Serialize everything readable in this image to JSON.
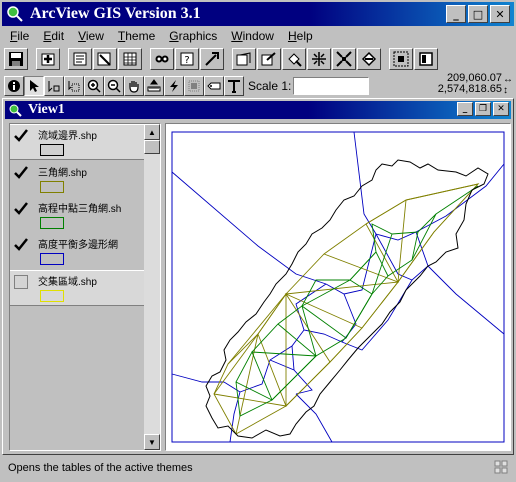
{
  "app": {
    "title": "ArcView GIS Version 3.1"
  },
  "menu": [
    "File",
    "Edit",
    "View",
    "Theme",
    "Graphics",
    "Window",
    "Help"
  ],
  "toolbar_buttons": [
    "save-icon",
    "add-theme-icon",
    "theme-properties-icon",
    "edit-legend-icon",
    "open-table-icon",
    "find-icon",
    "query-icon",
    "locate-address-icon",
    "zoom-full-icon",
    "zoom-to-themes-icon",
    "zoom-to-selected-icon",
    "zoom-in-icon",
    "zoom-out-icon",
    "zoom-previous-icon",
    "select-features-icon",
    "layout-icon"
  ],
  "tools": [
    "info-tool-icon",
    "pointer-tool-icon",
    "vertex-edit-icon",
    "select-box-icon",
    "zoom-in-tool-icon",
    "zoom-out-tool-icon",
    "pan-icon",
    "measure-icon",
    "hotlink-icon",
    "area-select-icon",
    "label-icon",
    "text-tool-icon"
  ],
  "scale": {
    "label": "Scale 1:",
    "value": ""
  },
  "coords": {
    "x": "209,060.07",
    "y": "2,574,818.65"
  },
  "view": {
    "title": "View1"
  },
  "themes": [
    {
      "name": "流域邊界.shp",
      "checked": true,
      "color": "#808080"
    },
    {
      "name": "三角網.shp",
      "checked": true,
      "color": "#808000"
    },
    {
      "name": "高程中點三角網.sh",
      "checked": true,
      "color": "#008000"
    },
    {
      "name": "高度平衡多邊形網",
      "checked": true,
      "color": "#0000c0"
    },
    {
      "name": "交集區域.shp",
      "checked": false,
      "color": "#e0e000"
    }
  ],
  "status": {
    "text": "Opens the tables of the active themes"
  },
  "colors": {
    "title_bar": "#000080",
    "boundary": "#000000",
    "tin": "#808000",
    "mid_tin": "#008000",
    "thiessen": "#0000c0"
  }
}
